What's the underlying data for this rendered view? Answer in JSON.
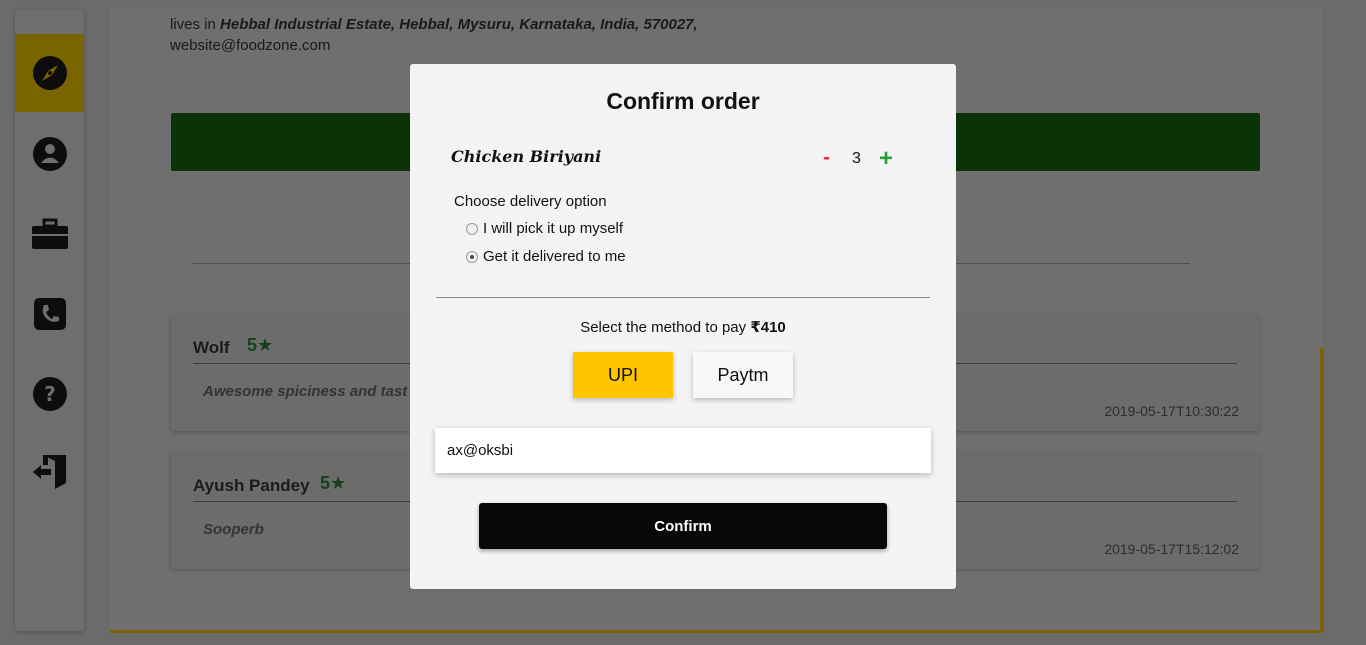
{
  "background": {
    "sidebar": {
      "items": [
        {
          "icon": "compass-icon",
          "active": true
        },
        {
          "icon": "user-icon",
          "active": false
        },
        {
          "icon": "briefcase-icon",
          "active": false
        },
        {
          "icon": "phone-icon",
          "active": false
        },
        {
          "icon": "help-icon",
          "active": false
        },
        {
          "icon": "logout-icon",
          "active": false
        }
      ]
    },
    "profile": {
      "lives_prefix": "lives in",
      "address": "Hebbal Industrial Estate, Hebbal, Mysuru, Karnataka, India, 570027,",
      "email": "website@foodzone.com"
    },
    "reviews": [
      {
        "name": "Wolf",
        "rating": "5★",
        "text": "Awesome spiciness and tast",
        "date": "2019-05-17T10:30:22"
      },
      {
        "name": "Ayush Pandey",
        "rating": "5★",
        "text": "Sooperb",
        "date": "2019-05-17T15:12:02"
      }
    ]
  },
  "modal": {
    "title": "Confirm order",
    "item": {
      "name": "Chicken Biriyani",
      "minus": "-",
      "quantity": "3",
      "plus": "+"
    },
    "delivery": {
      "prompt": "Choose delivery option",
      "options": [
        {
          "label": "I will pick it up myself",
          "selected": false
        },
        {
          "label": "Get it delivered to me",
          "selected": true
        }
      ]
    },
    "payment": {
      "prompt": "Select the method to pay",
      "amount": "₹410",
      "methods": [
        {
          "label": "UPI",
          "selected": true
        },
        {
          "label": "Paytm",
          "selected": false
        }
      ],
      "upi_id": "ax@oksbi"
    },
    "confirm_label": "Confirm"
  },
  "colors": {
    "accent": "#ffc400",
    "confirm_bg": "#080808",
    "minus": "#e03a3a",
    "plus": "#2a9c3a"
  }
}
